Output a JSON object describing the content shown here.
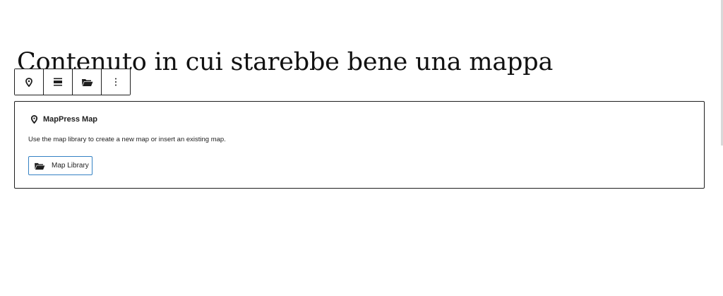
{
  "post": {
    "title": "Contenuto in cui starebbe bene una mappa"
  },
  "toolbar": {
    "buttons": [
      {
        "icon": "map-marker-icon",
        "label": "Block type"
      },
      {
        "icon": "align-icon",
        "label": "Align"
      },
      {
        "icon": "folder-open-icon",
        "label": "Map Library"
      },
      {
        "icon": "more-vertical-icon",
        "label": "Options"
      }
    ]
  },
  "block": {
    "label": "MapPress Map",
    "label_icon": "map-marker-icon",
    "instructions": "Use the map library to create a new map or insert an existing map.",
    "library_button": {
      "icon": "folder-open-icon",
      "label": "Map Library"
    },
    "colors": {
      "button_border": "#3582c4",
      "block_border": "#1e1e1e"
    }
  }
}
